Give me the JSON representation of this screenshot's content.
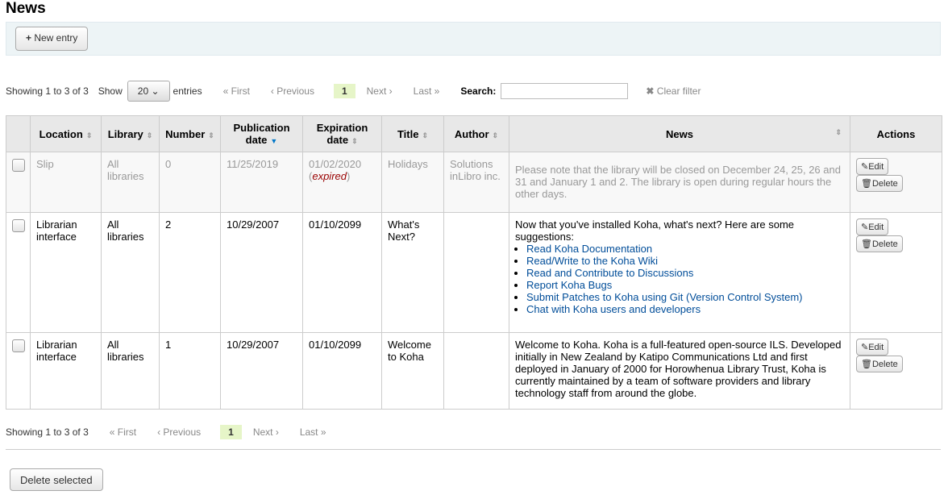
{
  "page_title": "News",
  "toolbar": {
    "new_entry": "New entry"
  },
  "pager": {
    "showing": "Showing 1 to 3 of 3",
    "show": "Show",
    "page_size": "20",
    "entries": "entries",
    "first": "« First",
    "previous": "‹ Previous",
    "current": "1",
    "next": "Next ›",
    "last": "Last »",
    "search_label": "Search:",
    "search_value": "",
    "clear_filter": "Clear filter"
  },
  "table": {
    "headers": [
      "",
      "Location",
      "Library",
      "Number",
      "Publication date",
      "Expiration date",
      "Title",
      "Author",
      "News",
      "Actions"
    ],
    "sorted_column": "Publication date",
    "rows": [
      {
        "location": "Slip",
        "library": "All libraries",
        "number": "0",
        "pub_date": "11/25/2019",
        "exp_date": "01/02/2020",
        "expired": "expired",
        "title": "Holidays",
        "author": "Solutions inLibro inc.",
        "news": "Please note that the library will be closed on December 24, 25, 26 and 31 and January 1 and 2. The library is open during regular hours the other days."
      },
      {
        "location": "Librarian interface",
        "library": "All libraries",
        "number": "2",
        "pub_date": "10/29/2007",
        "exp_date": "01/10/2099",
        "title": "What's Next?",
        "author": "",
        "news": "Now that you've installed Koha, what's next? Here are some suggestions:",
        "links": [
          "Read Koha Documentation",
          "Read/Write to the Koha Wiki",
          "Read and Contribute to Discussions",
          "Report Koha Bugs",
          "Submit Patches to Koha using Git (Version Control System)",
          "Chat with Koha users and developers"
        ]
      },
      {
        "location": "Librarian interface",
        "library": "All libraries",
        "number": "1",
        "pub_date": "10/29/2007",
        "exp_date": "01/10/2099",
        "title": "Welcome to Koha",
        "author": "",
        "news": "Welcome to Koha. Koha is a full-featured open-source ILS. Developed initially in New Zealand by Katipo Communications Ltd and first deployed in January of 2000 for Horowhenua Library Trust, Koha is currently maintained by a team of software providers and library technology staff from around the globe."
      }
    ],
    "edit": "Edit",
    "delete": "Delete"
  },
  "footer": {
    "delete_selected": "Delete selected"
  }
}
